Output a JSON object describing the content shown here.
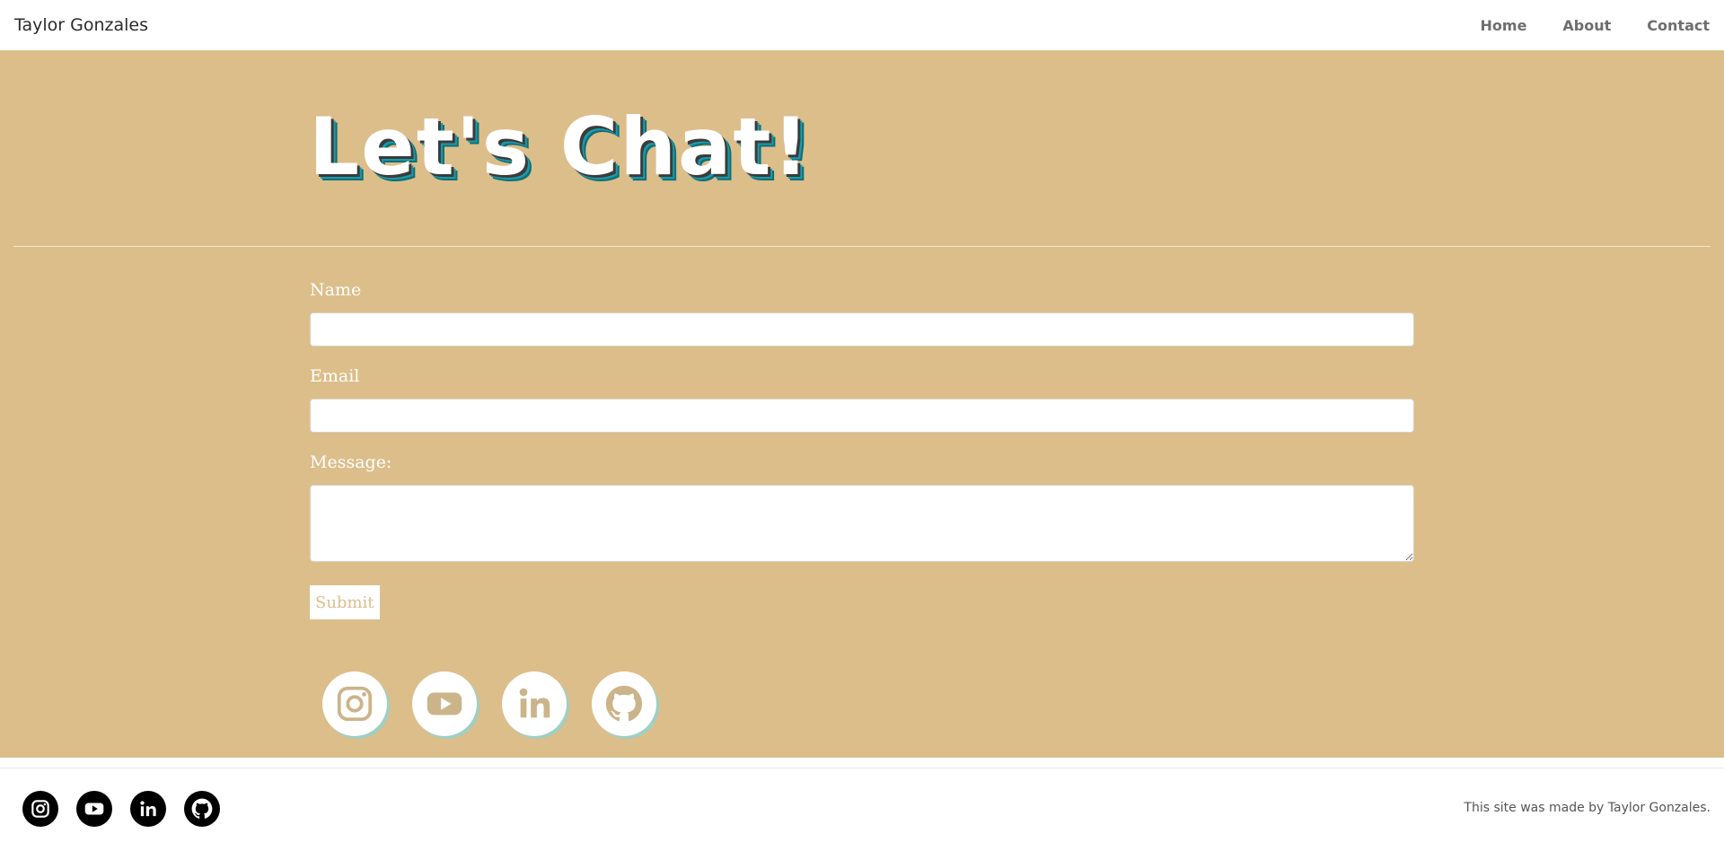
{
  "navbar": {
    "brand": "Taylor Gonzales",
    "links": [
      {
        "label": "Home"
      },
      {
        "label": "About"
      },
      {
        "label": "Contact"
      }
    ]
  },
  "main": {
    "heading": "Let's Chat!",
    "form": {
      "name_label": "Name",
      "name_value": "",
      "email_label": "Email",
      "email_value": "",
      "message_label": "Message:",
      "message_value": "",
      "submit_label": "Submit"
    },
    "social_icons": [
      {
        "icon": "instagram-icon"
      },
      {
        "icon": "youtube-icon"
      },
      {
        "icon": "linkedin-icon"
      },
      {
        "icon": "github-icon"
      }
    ]
  },
  "footer": {
    "icons": [
      {
        "icon": "instagram-icon"
      },
      {
        "icon": "youtube-icon"
      },
      {
        "icon": "linkedin-icon"
      },
      {
        "icon": "github-icon"
      }
    ],
    "credit": "This site was made by Taylor Gonzales."
  },
  "colors": {
    "accent_tan": "#dcbe8b",
    "heading_shadow_teal": "#1c9aa7",
    "social_shadow": "#9ecfc4"
  }
}
